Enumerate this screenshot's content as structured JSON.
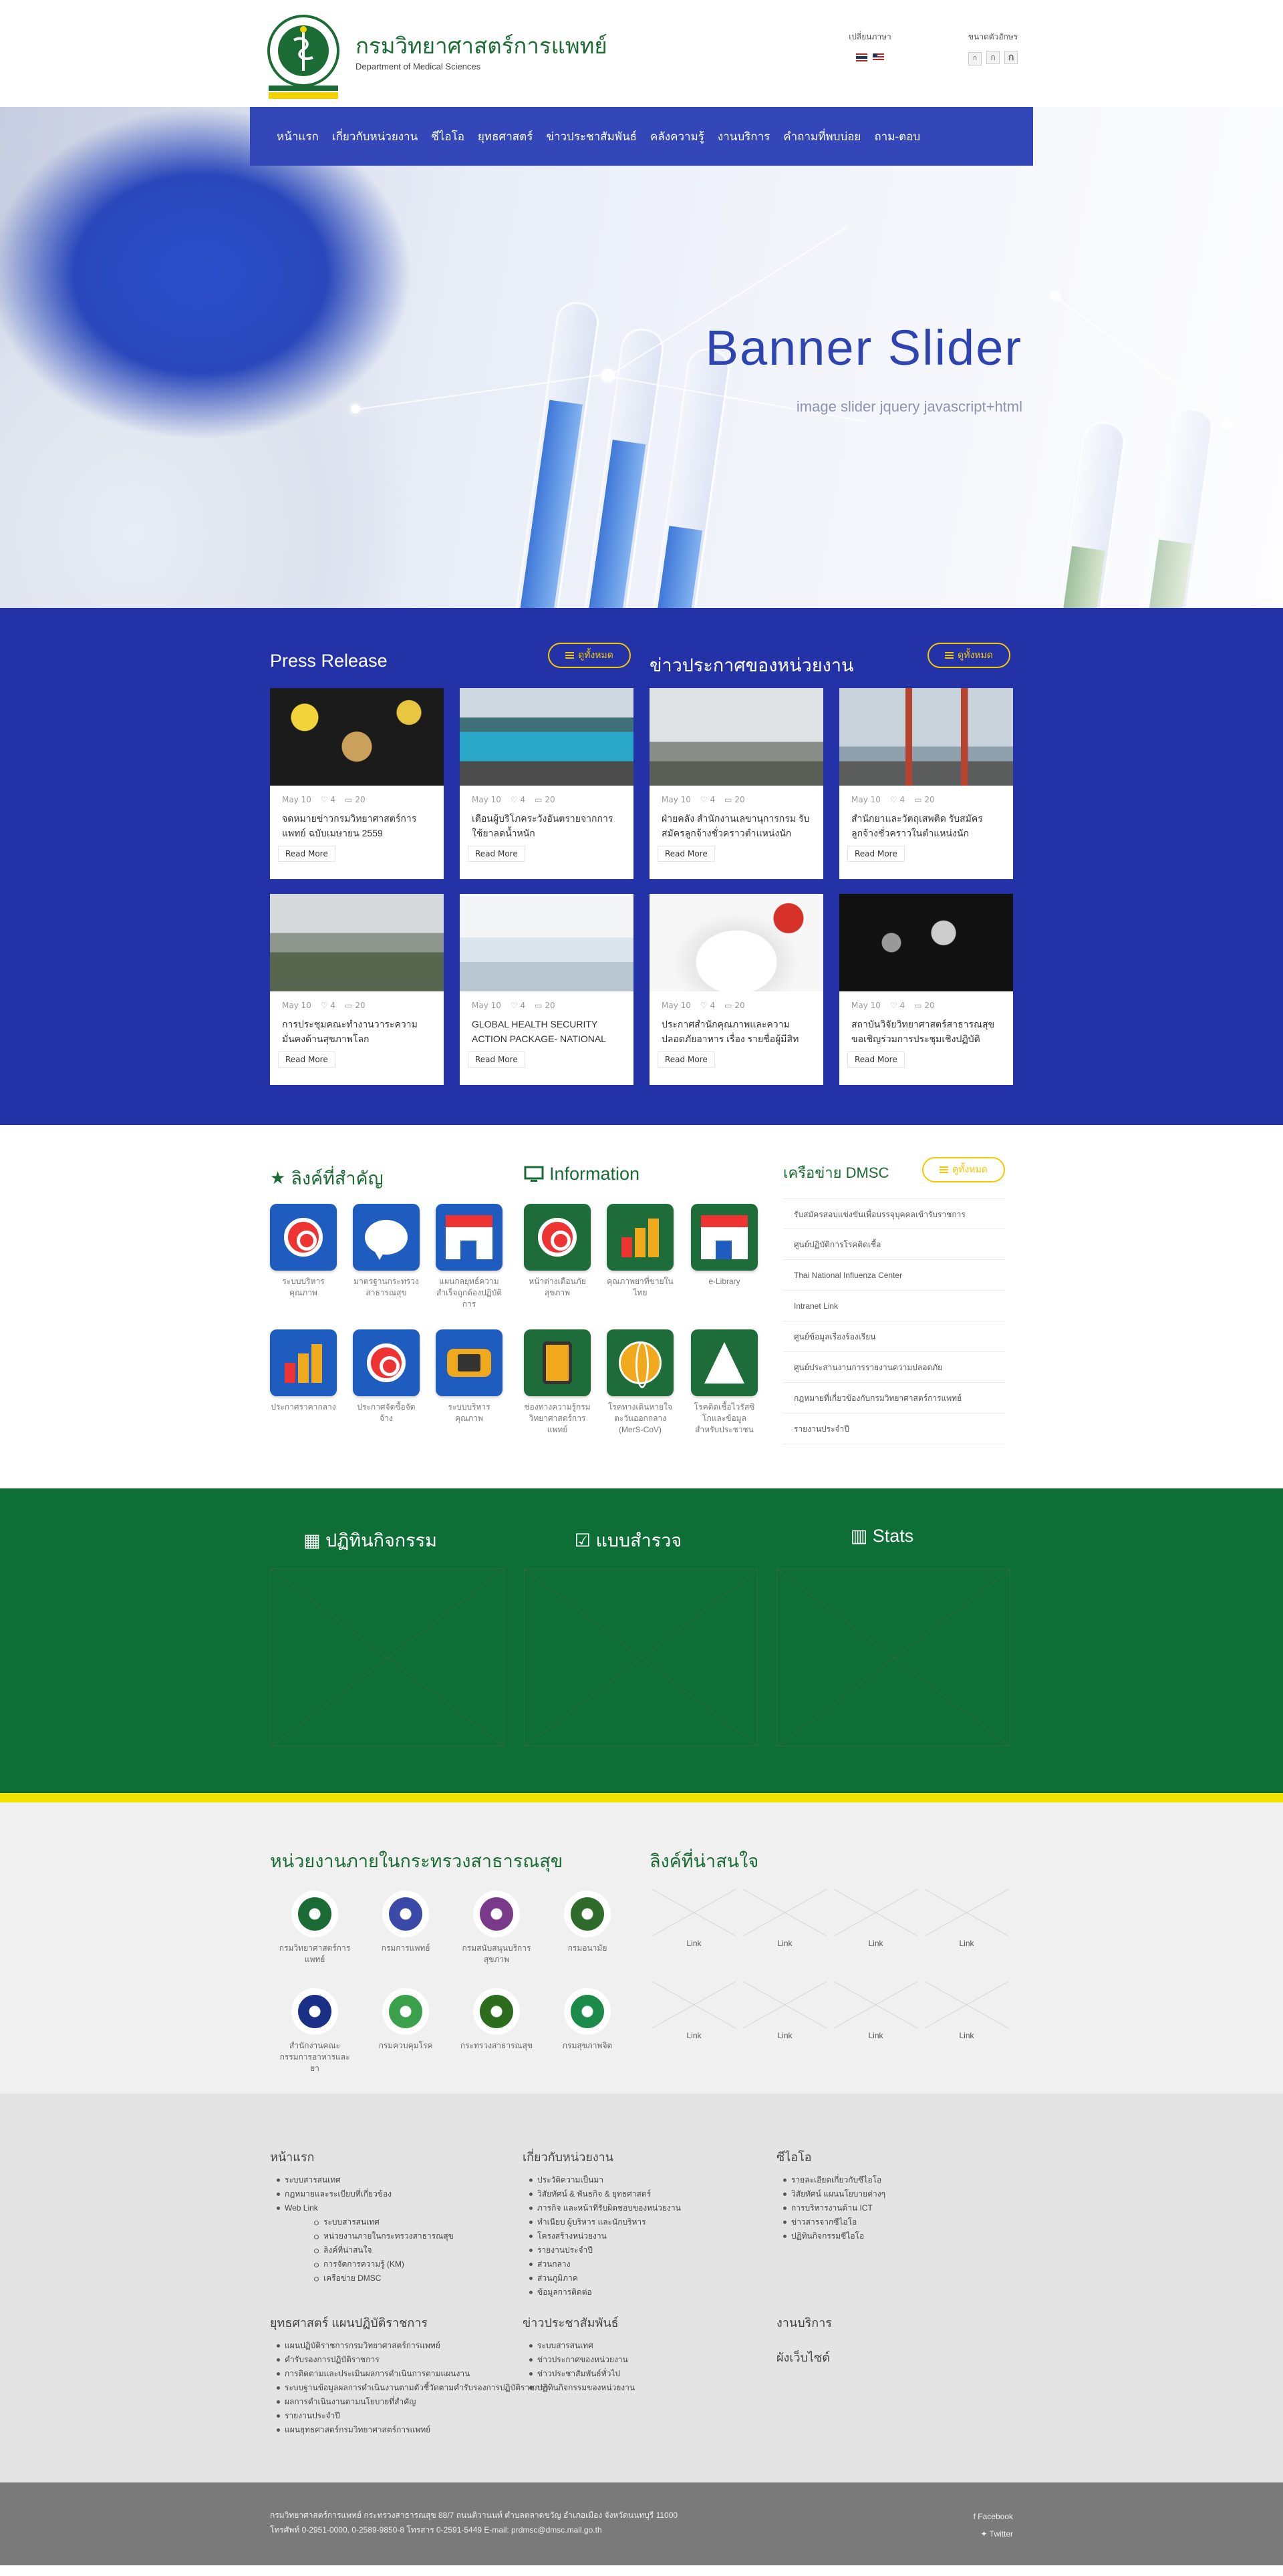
{
  "header": {
    "site_title": "กรมวิทยาศาสตร์การแพทย์",
    "site_subtitle": "Department of Medical Sciences",
    "language_label": "เปลี่ยนภาษา",
    "font_size_label": "ขนาดตัวอักษร",
    "font_buttons": [
      "ก",
      "ก",
      "ก"
    ]
  },
  "nav": [
    "หน้าแรก",
    "เกี่ยวกับหน่วยงาน",
    "ซีไอโอ",
    "ยุทธศาสตร์",
    "ข่าวประชาสัมพันธ์",
    "คลังความรู้",
    "งานบริการ",
    "คำถามที่พบบ่อย",
    "ถาม-ตอบ"
  ],
  "banner": {
    "title": "Banner Slider",
    "subtitle": "image slider jquery javascript+html"
  },
  "news": {
    "press_title": "Press Release",
    "announce_title": "ข่าวประกาศของหน่วยงาน",
    "view_all": "ดูทั้งหมด",
    "cards": [
      {
        "date": "May 10",
        "likes": "4",
        "comments": "20",
        "title": "จดหมายข่าวกรมวิทยาศาสตร์การแพทย์ ฉบับเมษายน 2559",
        "more": "Read More",
        "img": "food"
      },
      {
        "date": "May 10",
        "likes": "4",
        "comments": "20",
        "title": "เตือนผู้บริโภคระวังอันตรายจากการใช้ยาลดน้ำหนัก",
        "more": "Read More",
        "img": "lagoon"
      },
      {
        "date": "May 10",
        "likes": "4",
        "comments": "20",
        "title": "ฝ่ายคลัง สำนักงานเลขานุการกรม รับสมัครลูกจ้างชั่วคราวตำแหน่งนัก",
        "more": "Read More",
        "img": "fog"
      },
      {
        "date": "May 10",
        "likes": "4",
        "comments": "20",
        "title": "สำนักยาและวัตถุเสพติด รับสมัครลูกจ้างชั่วคราวในตำแหน่งนัก",
        "more": "Read More",
        "img": "bridge"
      },
      {
        "date": "May 10",
        "likes": "4",
        "comments": "20",
        "title": "การประชุมคณะทำงานวาระความมั่นคงด้านสุขภาพโลก",
        "more": "Read More",
        "img": "mountain"
      },
      {
        "date": "May 10",
        "likes": "4",
        "comments": "20",
        "title": "GLOBAL HEALTH SECURITY ACTION PACKAGE- NATIONAL",
        "more": "Read More",
        "img": "sky"
      },
      {
        "date": "May 10",
        "likes": "4",
        "comments": "20",
        "title": "ประกาศสำนักคุณภาพและความปลอดภัยอาหาร เรื่อง รายชื่อผู้มีสิท",
        "more": "Read More",
        "img": "yogurt"
      },
      {
        "date": "May 10",
        "likes": "4",
        "comments": "20",
        "title": "สถาบันวิจัยวิทยาศาสตร์สาธารณสุข ขอเชิญร่วมการประชุมเชิงปฏิบัติ",
        "more": "Read More",
        "img": "concert"
      }
    ]
  },
  "links": {
    "important_title": "ลิงค์ที่สำคัญ",
    "information_title": "Information",
    "network_title": "เครือข่าย DMSC",
    "view_all": "ดูทั้งหมด",
    "important": [
      {
        "caption": "ระบบบริหารคุณภาพ",
        "icon": "target-icon",
        "color": "blue"
      },
      {
        "caption": "มาตรฐานกระทรวงสาธารณสุข",
        "icon": "chat-bubble-icon",
        "color": "blue"
      },
      {
        "caption": "แผนกลยุทธ์ความสำเร็จถูกต้องปฏิบัติการ",
        "icon": "shop-icon",
        "color": "blue"
      },
      {
        "caption": "ประกาศราคากลาง",
        "icon": "bar-chart-icon",
        "color": "blue"
      },
      {
        "caption": "ประกาศจัดซื้อจัดจ้าง",
        "icon": "target-icon",
        "color": "blue"
      },
      {
        "caption": "ระบบบริหารคุณภาพ",
        "icon": "gamepad-icon",
        "color": "blue"
      }
    ],
    "information": [
      {
        "caption": "หน้าต่างเตือนภัยสุขภาพ",
        "icon": "target-icon",
        "color": "green"
      },
      {
        "caption": "คุณภาพยาที่ขายในไทย",
        "icon": "bar-chart-icon",
        "color": "green"
      },
      {
        "caption": "e-Library",
        "icon": "shop-icon",
        "color": "green"
      },
      {
        "caption": "ช่องทางความรู้กรมวิทยาศาสตร์การแพทย์",
        "icon": "tablet-icon",
        "color": "green"
      },
      {
        "caption": "โรคทางเดินหายใจตะวันออกกลาง (MerS-CoV)",
        "icon": "globe-icon",
        "color": "green"
      },
      {
        "caption": "โรคติดเชื้อไวรัสซิโกและข้อมูลสำหรับประชาชน",
        "icon": "navigation-arrow-icon",
        "color": "green"
      }
    ],
    "network": [
      "รับสมัครสอบแข่งขันเพื่อบรรจุบุคคลเข้ารับราชการ",
      "ศูนย์ปฏิบัติการโรคติดเชื้อ",
      "Thai National Influenza Center",
      "Intranet Link",
      "ศูนย์ข้อมูลเรื่องร้องเรียน",
      "ศูนย์ประสานงานการรายงานความปลอดภัย",
      "กฎหมายที่เกี่ยวข้องกับกรมวิทยาศาสตร์การแพทย์",
      "รายงานประจำปี"
    ]
  },
  "stats": {
    "activity_title": "ปฏิทินกิจกรรม",
    "survey_title": "แบบสำรวจ",
    "stats_title": "Stats"
  },
  "agencies": {
    "title": "หน่วยงานภายในกระทรวงสาธารณสุข",
    "links_title": "ลิงค์ที่น่าสนใจ",
    "items": [
      {
        "caption": "กรมวิทยาศาสตร์การแพทย์",
        "color": "#1b6b34"
      },
      {
        "caption": "กรมการแพทย์",
        "color": "#3b4aa8"
      },
      {
        "caption": "กรมสนับสนุนบริการสุขภาพ",
        "color": "#7a3a8a"
      },
      {
        "caption": "กรมอนามัย",
        "color": "#2f6b2a"
      },
      {
        "caption": "สำนักงานคณะกรรมการอาหารและยา",
        "color": "#1a2f86"
      },
      {
        "caption": "กรมควบคุมโรค",
        "color": "#3aa04a"
      },
      {
        "caption": "กระทรวงสาธารณสุข",
        "color": "#2b6d1c"
      },
      {
        "caption": "กรมสุขภาพจิต",
        "color": "#1b8a4a"
      }
    ],
    "link_labels": [
      "Link",
      "Link",
      "Link",
      "Link",
      "Link",
      "Link",
      "Link",
      "Link"
    ]
  },
  "footer": {
    "col1": {
      "title": "หน้าแรก",
      "items": [
        {
          "t": "ระบบสารสนเทศ",
          "sub": false
        },
        {
          "t": "กฎหมายและระเบียบที่เกี่ยวข้อง",
          "sub": false
        },
        {
          "t": "Web Link",
          "sub": false
        },
        {
          "t": "ระบบสารสนเทศ",
          "sub": true
        },
        {
          "t": "หน่วยงานภายในกระทรวงสาธารณสุข",
          "sub": true
        },
        {
          "t": "ลิงค์ที่น่าสนใจ",
          "sub": true
        },
        {
          "t": "การจัดการความรู้ (KM)",
          "sub": true
        },
        {
          "t": "เครือข่าย DMSC",
          "sub": true
        }
      ]
    },
    "col2": {
      "title": "เกี่ยวกับหน่วยงาน",
      "items": [
        {
          "t": "ประวัติความเป็นมา",
          "sub": false
        },
        {
          "t": "วิสัยทัศน์ & พันธกิจ & ยุทธศาสตร์",
          "sub": false
        },
        {
          "t": "ภารกิจ และหน้าที่รับผิดชอบของหน่วยงาน",
          "sub": false
        },
        {
          "t": "ทำเนียบ ผู้บริหาร และนักบริหาร",
          "sub": false
        },
        {
          "t": "โครงสร้างหน่วยงาน",
          "sub": false
        },
        {
          "t": "รายงานประจำปี",
          "sub": false
        },
        {
          "t": "ส่วนกลาง",
          "sub": false
        },
        {
          "t": "ส่วนภูมิภาค",
          "sub": false
        },
        {
          "t": "ข้อมูลการติดต่อ",
          "sub": false
        }
      ]
    },
    "col3": {
      "title": "ซีไอโอ",
      "items": [
        {
          "t": "รายละเอียดเกี่ยวกับซีไอโอ",
          "sub": false
        },
        {
          "t": "วิสัยทัศน์ แผนนโยบายต่างๆ",
          "sub": false
        },
        {
          "t": "การบริหารงานด้าน ICT",
          "sub": false
        },
        {
          "t": "ข่าวสารจากซีไอโอ",
          "sub": false
        },
        {
          "t": "ปฏิทินกิจกรรมซีไอโอ",
          "sub": false
        }
      ]
    },
    "col4": {
      "title": "ยุทธศาสตร์ แผนปฏิบัติราชการ",
      "items": [
        {
          "t": "แผนปฏิบัติราชการกรมวิทยาศาสตร์การแพทย์",
          "sub": false
        },
        {
          "t": "คำรับรองการปฏิบัติราชการ",
          "sub": false
        },
        {
          "t": "การติดตามและประเมินผลการดำเนินการตามแผนงาน",
          "sub": false
        },
        {
          "t": "ระบบฐานข้อมูลผลการดำเนินงานตามตัวชี้วัดตามคำรับรองการปฏิบัติราชการ",
          "sub": false
        },
        {
          "t": "ผลการดำเนินงานตามนโยบายที่สำคัญ",
          "sub": false
        },
        {
          "t": "รายงานประจำปี",
          "sub": false
        },
        {
          "t": "แผนยุทธศาสตร์กรมวิทยาศาสตร์การแพทย์",
          "sub": false
        }
      ]
    },
    "col5": {
      "title": "ข่าวประชาสัมพันธ์",
      "items": [
        {
          "t": "ระบบสารสนเทศ",
          "sub": false
        },
        {
          "t": "ข่าวประกาศของหน่วยงาน",
          "sub": false
        },
        {
          "t": "ข่าวประชาสัมพันธ์ทั่วไป",
          "sub": false
        },
        {
          "t": "ปฏิทินกิจกรรมของหน่วยงาน",
          "sub": false
        }
      ]
    },
    "col6": {
      "title": "งานบริการ",
      "items": []
    },
    "col7": {
      "title": "ผังเว็บไซต์",
      "items": []
    }
  },
  "bottom": {
    "address_line1": "กรมวิทยาศาสตร์การแพทย์ กระทรวงสาธารณสุข 88/7 ถนนติวานนท์ ตำบลตลาดขวัญ อำเภอเมือง จังหวัดนนทบุรี 11000",
    "address_line2": "โทรศัพท์ 0-2951-0000, 0-2589-9850-8 โทรสาร 0-2591-5449 E-mail: prdmsc@dmsc.mail.go.th",
    "facebook": "Facebook",
    "twitter": "Twitter"
  }
}
